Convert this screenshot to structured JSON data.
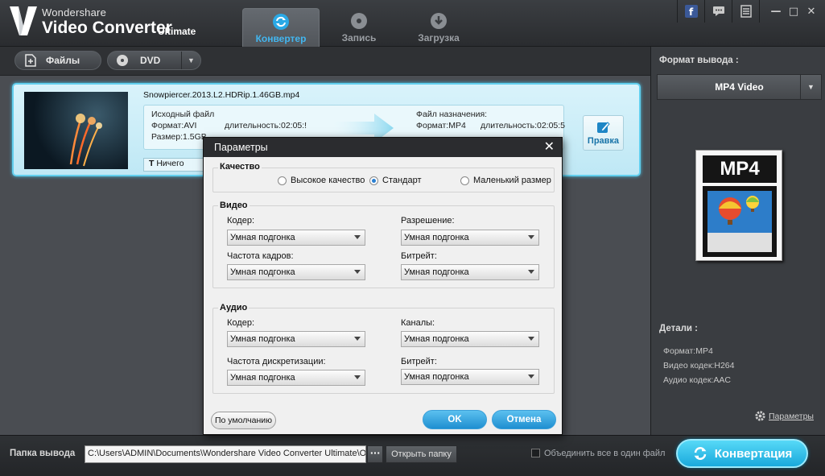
{
  "app": {
    "brand_small": "Wondershare",
    "brand_big": "Video Converter",
    "brand_edition": "Ultimate"
  },
  "tabs": [
    {
      "label": "Конвертер",
      "icon": "convert-icon",
      "active": true
    },
    {
      "label": "Запись",
      "icon": "disc-icon",
      "active": false
    },
    {
      "label": "Загрузка",
      "icon": "download-icon",
      "active": false
    }
  ],
  "toolbar": {
    "files_label": "Файлы",
    "dvd_label": "DVD"
  },
  "file": {
    "name": "Snowpiercer.2013.L2.HDRip.1.46GB.mp4",
    "source_title": "Исходный файл",
    "source_format": "Формат:AVI",
    "source_duration": "длительность:02:05:!",
    "source_size": "Размер:1.5GB",
    "dest_title": "Файл назначения:",
    "dest_format": "Формат:MP4",
    "dest_duration": "длительность:02:05:5",
    "subtitle_value": "Ничего",
    "edit_label": "Правка"
  },
  "right_panel": {
    "output_format_label": "Формат вывода :",
    "output_format_value": "MP4 Video",
    "format_icon_text": "MP4",
    "details_label": "Детали :",
    "details": [
      "Формат:MP4",
      "Видео кодек:H264",
      "Аудио кодек:AAC"
    ],
    "params_link": "Параметры"
  },
  "bottom": {
    "output_folder_label": "Папка вывода",
    "output_path": "C:\\Users\\ADMIN\\Documents\\Wondershare Video Converter Ultimate\\Ou",
    "more_label": "···",
    "open_folder_label": "Открыть папку",
    "merge_label": "Объединить все в один файл",
    "convert_label": "Конвертация"
  },
  "dialog": {
    "title": "Параметры",
    "quality": {
      "title": "Качество",
      "options": [
        "Высокое качество",
        "Стандарт",
        "Маленький размер"
      ],
      "selected": "Стандарт"
    },
    "video": {
      "title": "Видео",
      "codec_label": "Кодер:",
      "codec_value": "Умная подгонка",
      "resolution_label": "Разрешение:",
      "resolution_value": "Умная подгонка",
      "framerate_label": "Частота кадров:",
      "framerate_value": "Умная подгонка",
      "bitrate_label": "Битрейт:",
      "bitrate_value": "Умная подгонка"
    },
    "audio": {
      "title": "Аудио",
      "codec_label": "Кодер:",
      "codec_value": "Умная подгонка",
      "channels_label": "Каналы:",
      "channels_value": "Умная подгонка",
      "samplerate_label": "Частота дискретизации:",
      "samplerate_value": "Умная подгонка",
      "bitrate_label": "Битрейт:",
      "bitrate_value": "Умная подгонка"
    },
    "default_label": "По умолчанию",
    "ok_label": "OK",
    "cancel_label": "Отмена"
  },
  "colors": {
    "accent": "#1fa6dc",
    "tab_active_text": "#42b6f0",
    "file_card_border": "#62cfee"
  }
}
